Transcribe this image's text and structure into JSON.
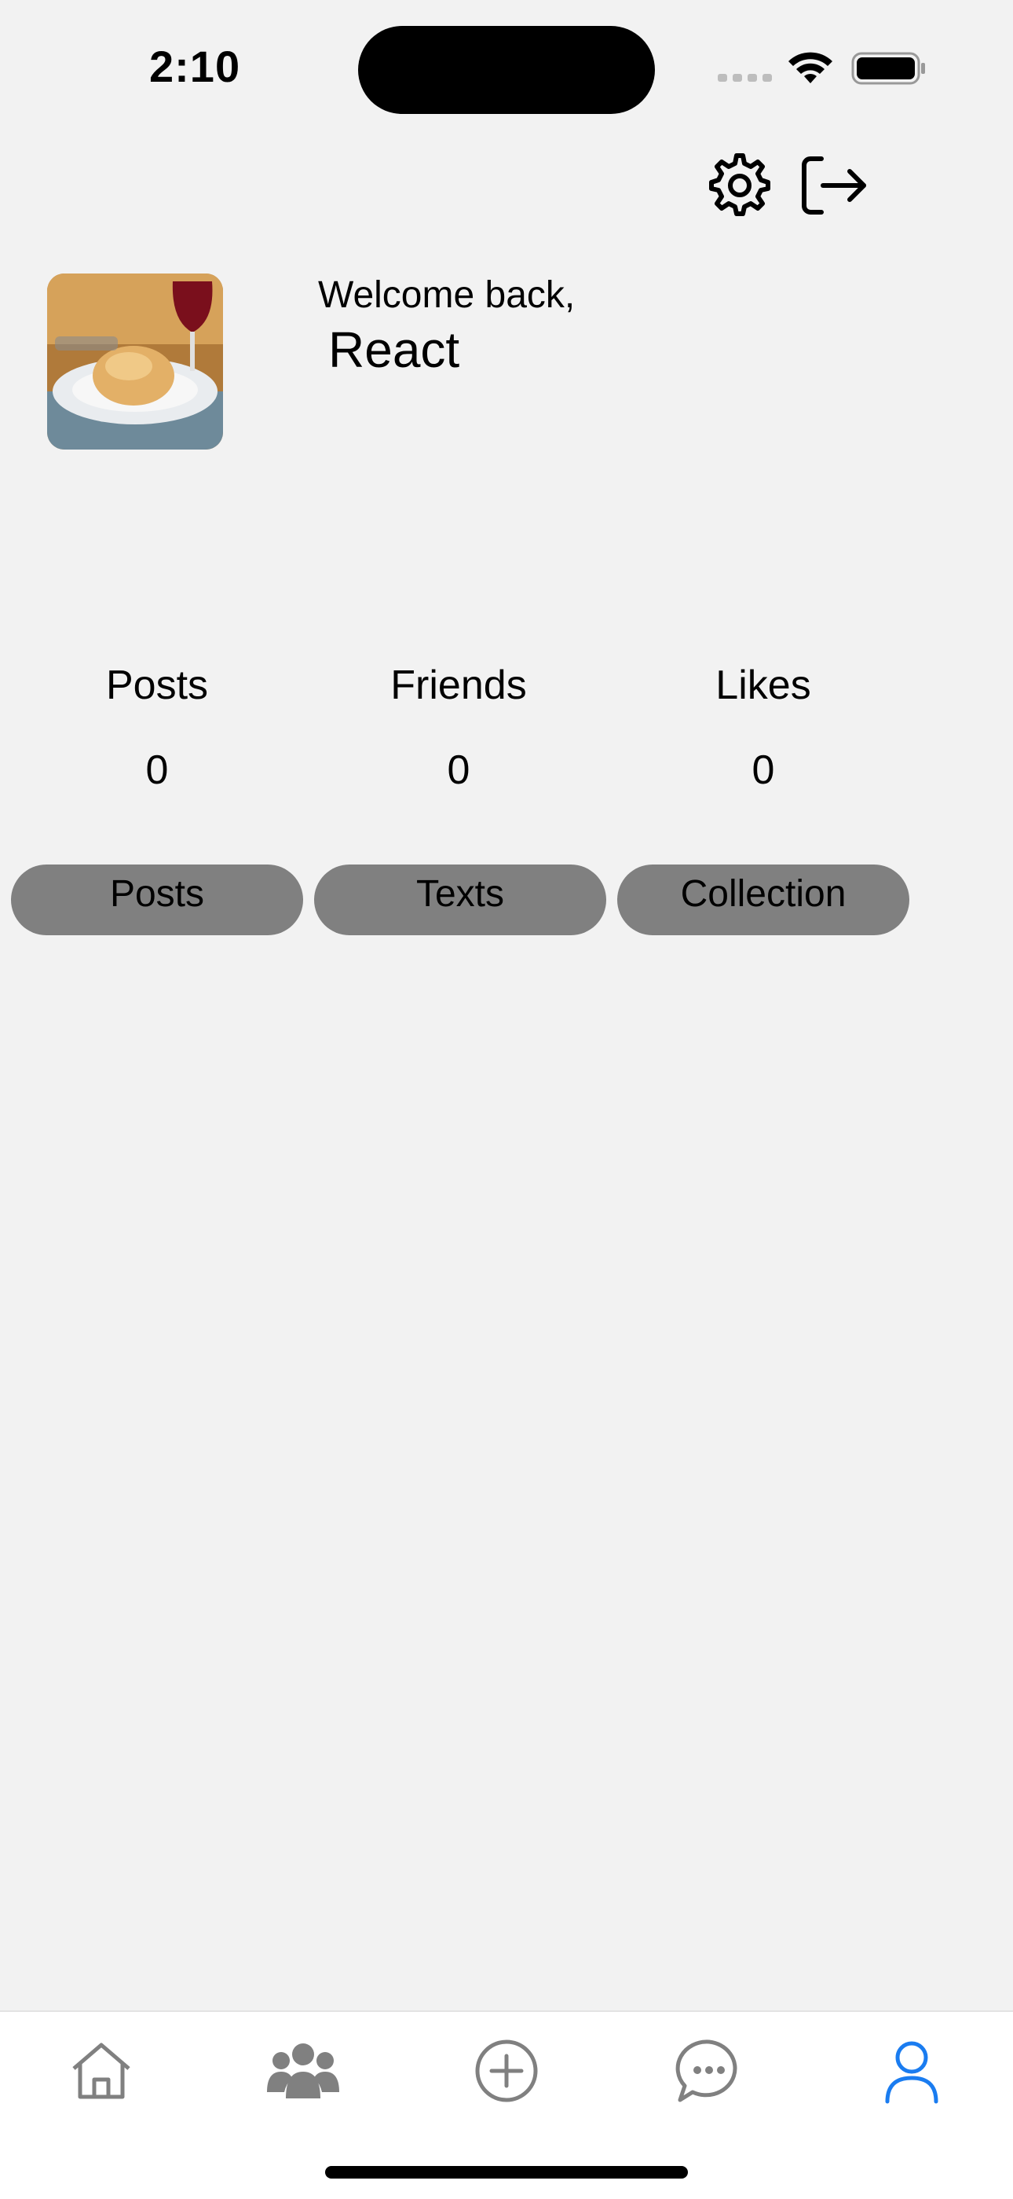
{
  "status_bar": {
    "time": "2:10"
  },
  "header_actions": {
    "settings_icon": "gear-icon",
    "logout_icon": "logout-icon"
  },
  "profile": {
    "welcome": "Welcome back,",
    "name": "React",
    "avatar_icon": "food-photo"
  },
  "stats": [
    {
      "label": "Posts",
      "value": "0"
    },
    {
      "label": "Friends",
      "value": "0"
    },
    {
      "label": "Likes",
      "value": "0"
    }
  ],
  "segments": [
    {
      "label": "Posts"
    },
    {
      "label": "Texts"
    },
    {
      "label": "Collection"
    }
  ],
  "tab_bar": {
    "items": [
      {
        "icon": "home-icon",
        "active": false
      },
      {
        "icon": "people-icon",
        "active": false
      },
      {
        "icon": "plus-circle-icon",
        "active": false
      },
      {
        "icon": "chat-icon",
        "active": false
      },
      {
        "icon": "profile-icon",
        "active": true
      }
    ],
    "active_color": "#1a7cf0",
    "inactive_color": "#808080"
  }
}
